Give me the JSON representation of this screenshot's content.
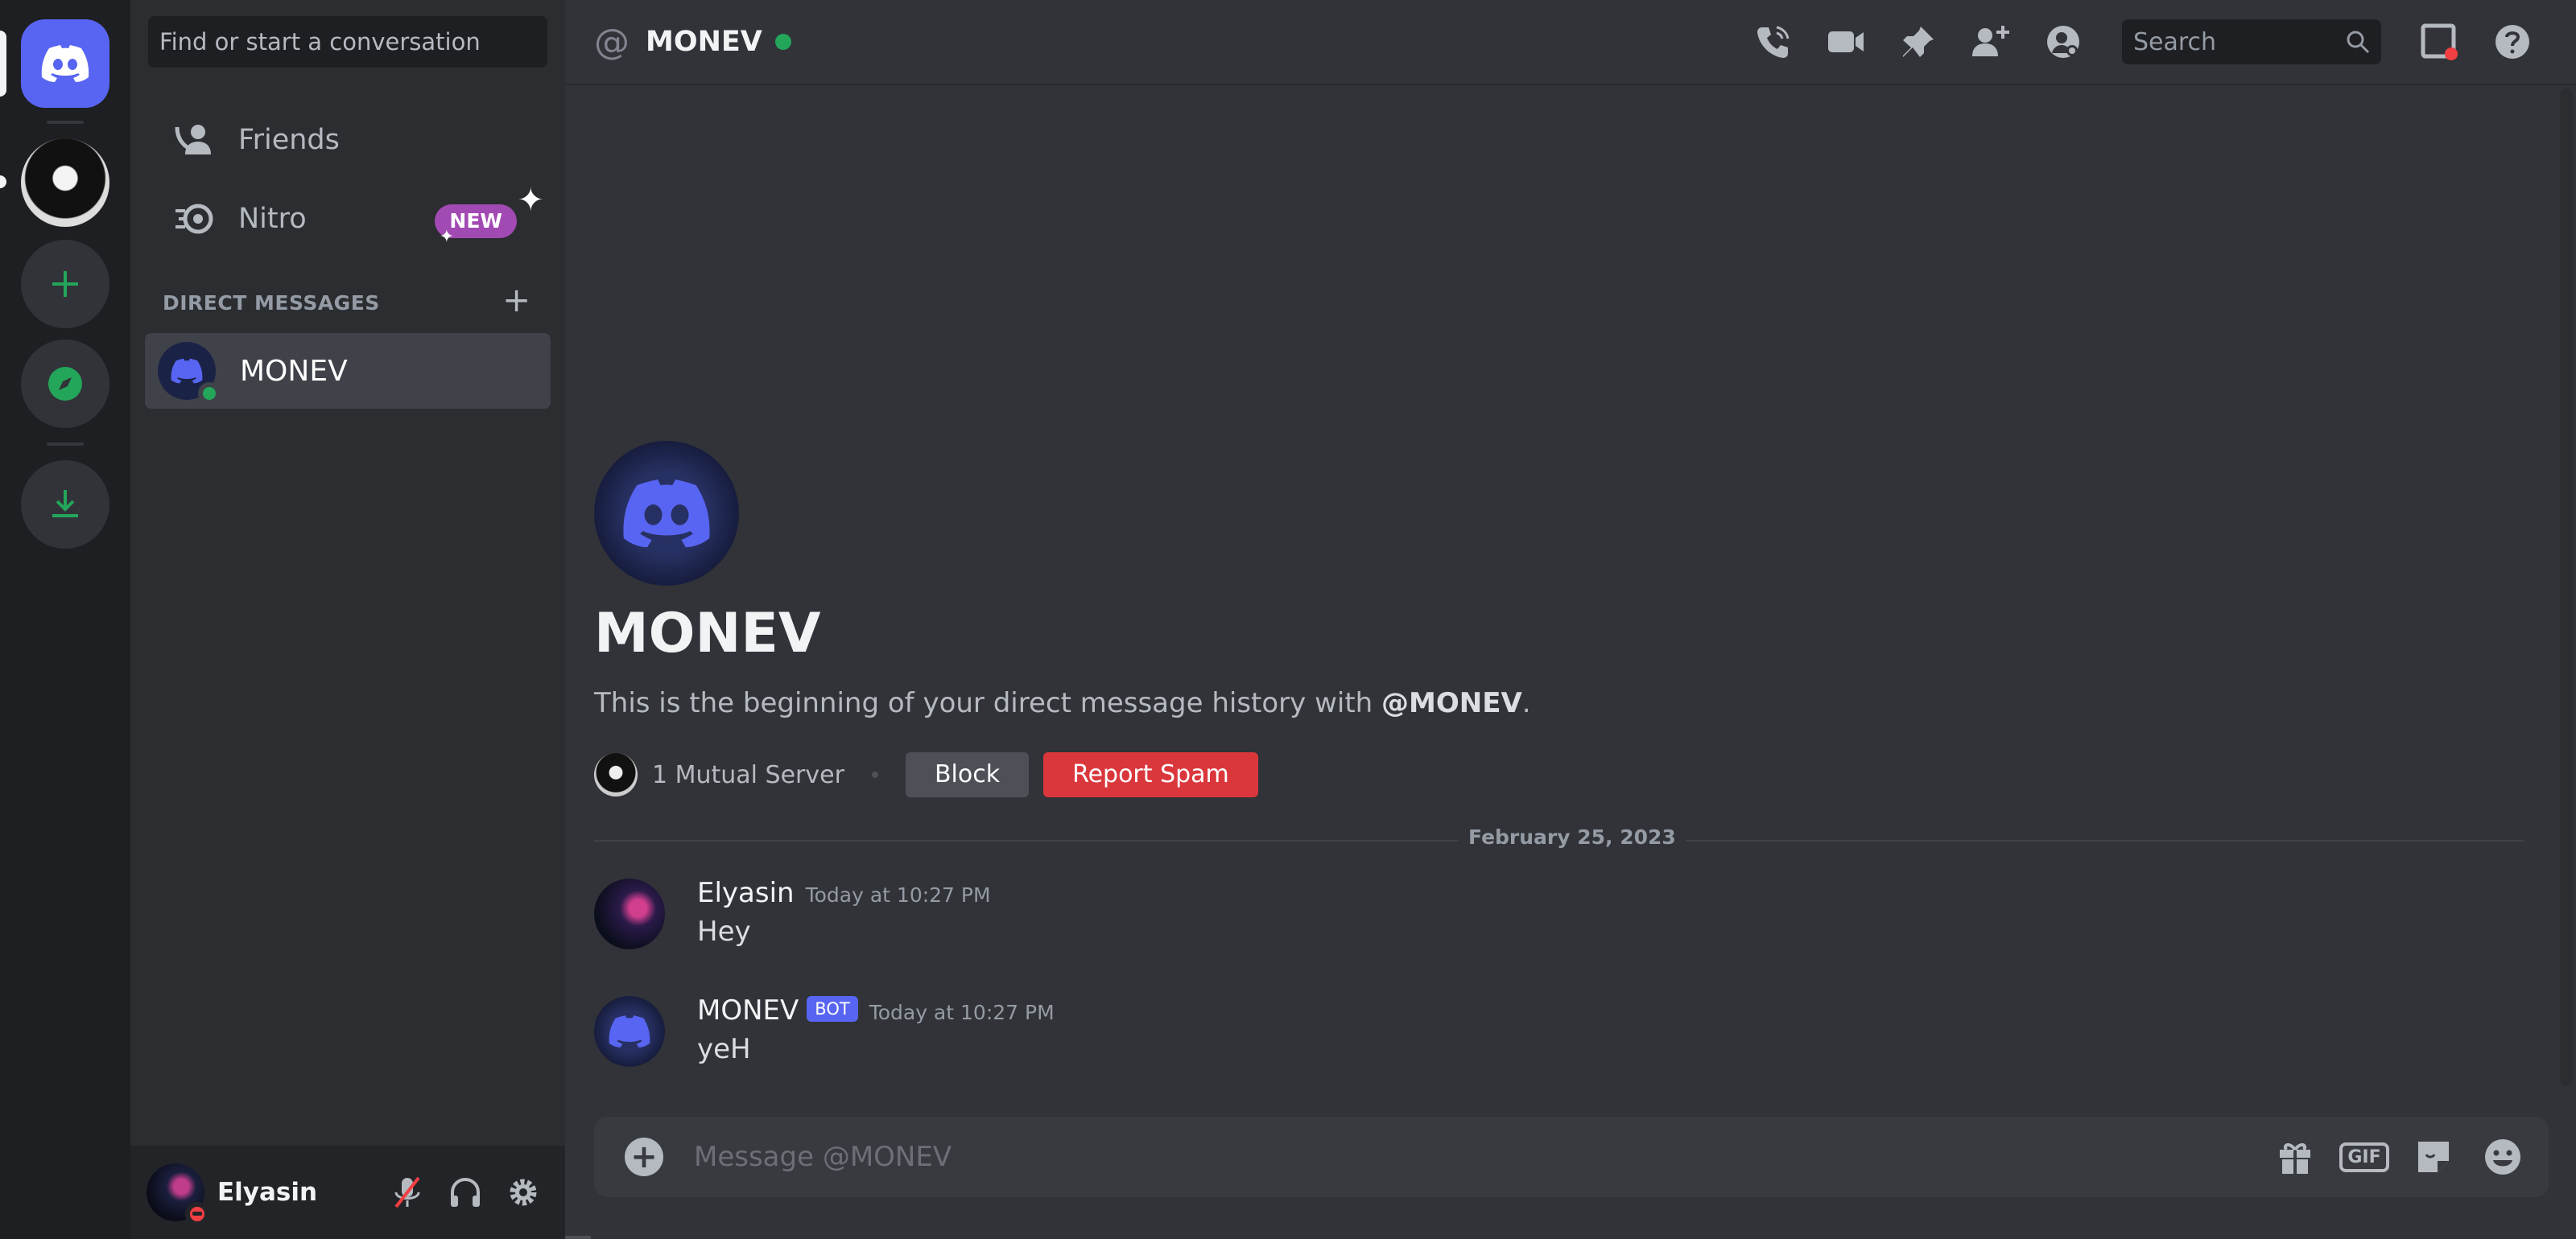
{
  "sidebar": {
    "search_placeholder": "Find or start a conversation",
    "nav": [
      {
        "label": "Friends",
        "icon": "friends-icon"
      },
      {
        "label": "Nitro",
        "icon": "nitro-icon",
        "badge": "NEW"
      }
    ],
    "dm_header": "DIRECT MESSAGES",
    "dm_add": "+",
    "dms": [
      {
        "name": "MONEV",
        "status": "online"
      }
    ]
  },
  "user_panel": {
    "name": "Elyasin",
    "status": "dnd"
  },
  "channel": {
    "name": "MONEV",
    "status": "online",
    "search_placeholder": "Search"
  },
  "intro": {
    "name": "MONEV",
    "text_prefix": "This is the beginning of your direct message history with",
    "mention": "@MONEV",
    "text_suffix": ".",
    "mutual": "1 Mutual Server",
    "block_label": "Block",
    "spam_label": "Report Spam"
  },
  "divider_date": "February 25, 2023",
  "messages": [
    {
      "author": "Elyasin",
      "time": "Today at 10:27 PM",
      "text": "Hey"
    },
    {
      "author": "MONEV",
      "bot_tag": "BOT",
      "time": "Today at 10:27 PM",
      "text": "yeH"
    }
  ],
  "composer": {
    "placeholder": "Message @MONEV",
    "gif_label": "GIF"
  },
  "colors": {
    "blurple": "#5865f2",
    "online": "#23a55a",
    "danger": "#da373c",
    "nitro_badge": "#a24ab3"
  }
}
